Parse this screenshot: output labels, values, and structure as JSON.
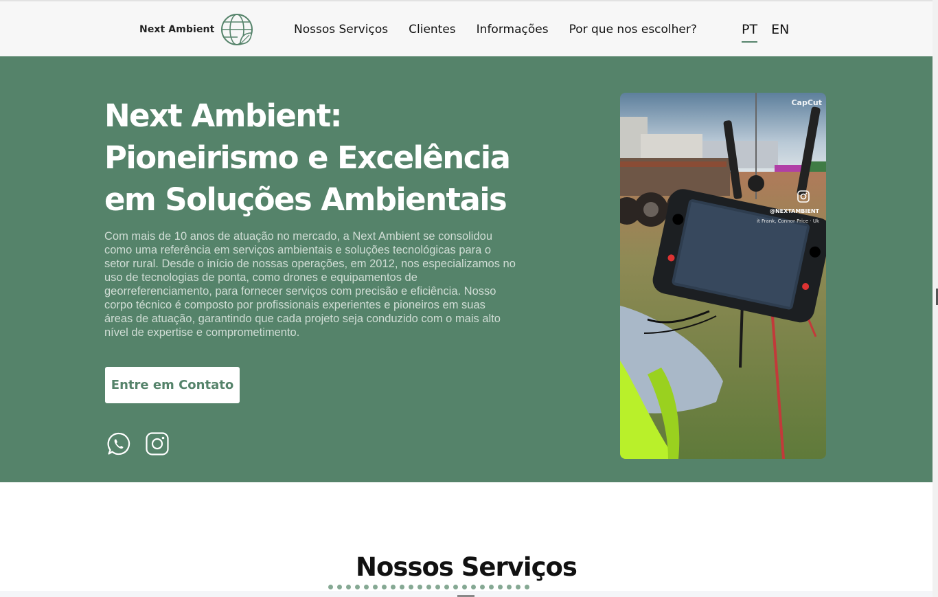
{
  "header": {
    "logo_text": "Next Ambient",
    "nav": [
      {
        "label": "Nossos Serviços"
      },
      {
        "label": "Clientes"
      },
      {
        "label": "Informações"
      },
      {
        "label": "Por que nos escolher?"
      }
    ],
    "languages": [
      {
        "label": "PT",
        "active": true
      },
      {
        "label": "EN",
        "active": false
      }
    ]
  },
  "hero": {
    "title_lines": [
      "Next Ambient:",
      "Pioneirismo e Excelência",
      "em Soluções Ambientais"
    ],
    "description": "Com mais de 10 anos de atuação no mercado, a Next Ambient se consolidou como uma referência em serviços ambientais e soluções tecnológicas para o setor rural. Desde o início de nossas operações, em 2012, nos especializamos no uso de tecnologias de ponta, como drones e equipamentos de georreferenciamento, para fornecer serviços com precisão e eficiência. Nosso corpo técnico é composto por profissionais experientes e pioneiros em suas áreas de atuação, garantindo que cada projeto seja conduzido com o mais alto nível de expertise e comprometimento.",
    "cta_label": "Entre em Contato",
    "social": [
      {
        "name": "whatsapp-icon"
      },
      {
        "name": "instagram-icon"
      }
    ],
    "video": {
      "watermark": "CapCut",
      "handle": "@NEXTAMBIENT",
      "credit": "it Frank, Connor Price · Uk"
    }
  },
  "services": {
    "title": "Nossos Serviços",
    "dot_count": 23
  },
  "colors": {
    "brand_green": "#55836a",
    "header_bg": "#f7f7f7",
    "hero_text": "#d0ddd5"
  }
}
